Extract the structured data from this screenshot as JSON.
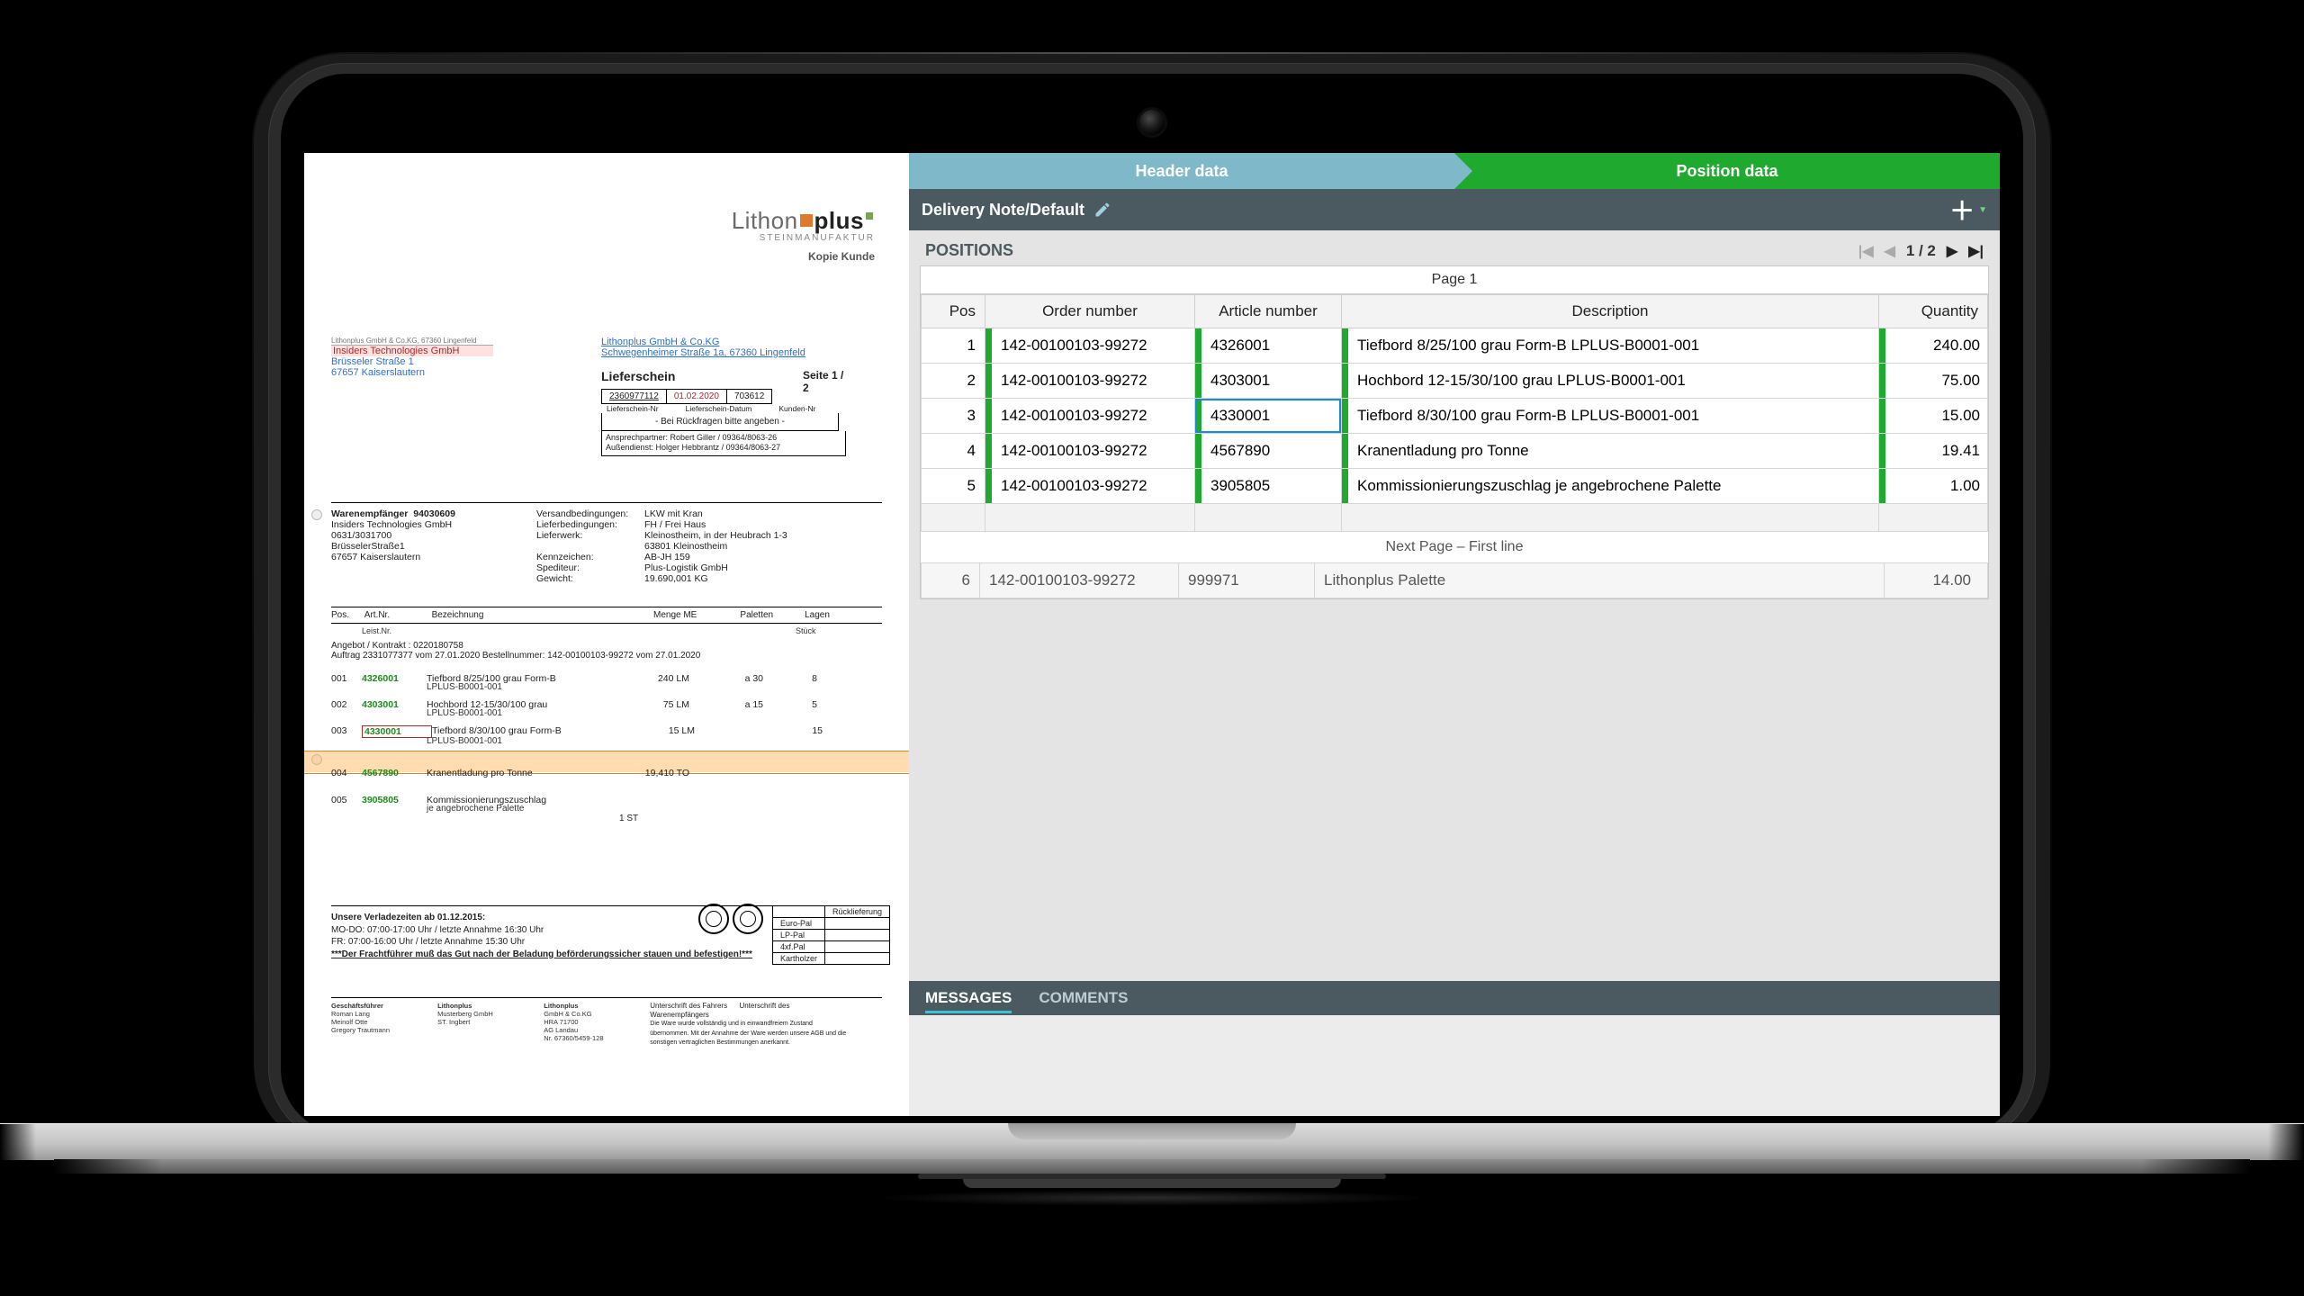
{
  "brand": {
    "name_a": "Lithon",
    "name_b": "plus",
    "sub": "STEINMANUFAKTUR",
    "copy": "Kopie Kunde"
  },
  "sender": {
    "top": "Lithonplus GmbH & Co.KG, 67360 Lingenfeld",
    "l1": "Insiders Technologies GmbH",
    "l2": "Brüsseler Straße 1",
    "l3": "67657 Kaiserslautern"
  },
  "recipient": {
    "l1": "Lithonplus GmbH & Co.KG",
    "l2": "Schwegenheimer Straße 1a, 67360 Lingenfeld"
  },
  "lieferschein": {
    "title": "Lieferschein",
    "page": "Seite 1  /  2",
    "no": "2360977112",
    "date": "01.02.2020",
    "order": "703612",
    "hint": "- Bei Rückfragen bitte angeben -",
    "asp1": "Ansprechpartner: Robert Giller / 09364/8063-26",
    "asp2": "Außendienst: Holger Hebbrantz / 09364/8063-27"
  },
  "meta": {
    "warenempf_lab": "Warenempfänger",
    "warenempf_val": "94030609",
    "c1_l2": "Insiders Technologies GmbH",
    "c1_l3": "0631/3031700",
    "c1_l4": "BrüsselerStraße1",
    "c1_l5": "67657 Kaiserslautern",
    "vb_lab": "Versandbedingungen:",
    "vb_val": "LKW mit Kran",
    "lb_lab": "Lieferbedingungen:",
    "lb_val": "FH / Frei Haus",
    "lw_lab": "Lieferwerk:",
    "lw_val": "Kleinostheim, in der Heubrach 1-3",
    "lw_val2": "63801 Kleinostheim",
    "kz_lab": "Kennzeichen:",
    "kz_val": "AB-JH 159",
    "sp_lab": "Spediteur:",
    "sp_val": "Plus-Logistik GmbH",
    "gw_lab": "Gewicht:",
    "gw_val": "19.690,001 KG"
  },
  "itemsHeader": {
    "pos": "Pos.",
    "art": "Art.Nr.",
    "bez": "Bezeichnung",
    "menge": "Menge  ME",
    "pal": "Paletten",
    "lagen": "Lagen",
    "sub": "Leist.Nr.",
    "sub2": "Stück"
  },
  "angebot": "Angebot / Kontrakt : 0220180758",
  "auftrag": "Auftrag 2331077377  vom 27.01.2020  Bestellnummer: 142-00100103-99272  vom 27.01.2020",
  "docItems": [
    {
      "pos": "001",
      "art": "4326001",
      "bez": "Tiefbord 8/25/100 grau Form-B",
      "me": "240 LM",
      "pal": "a 30",
      "lag": "8",
      "sub": "LPLUS-B0001-001"
    },
    {
      "pos": "002",
      "art": "4303001",
      "bez": "Hochbord 12-15/30/100 grau",
      "me": "75 LM",
      "pal": "a 15",
      "lag": "5",
      "sub": "LPLUS-B0001-001"
    },
    {
      "pos": "003",
      "art": "4330001",
      "bez": "Tiefbord 8/30/100 grau Form-B",
      "me": "15 LM",
      "pal": "",
      "lag": "15",
      "sub": "LPLUS-B0001-001"
    },
    {
      "pos": "004",
      "art": "4567890",
      "bez": "Kranentladung pro Tonne",
      "me": "19,410 TO",
      "pal": "",
      "lag": "",
      "sub": ""
    },
    {
      "pos": "005",
      "art": "3905805",
      "bez": "Kommissionierungszuschlag",
      "me": "1 ST",
      "pal": "",
      "lag": "",
      "sub": "je angebrochene Palette"
    }
  ],
  "foot": {
    "l1": "Unsere Verladezeiten ab 01.12.2015:",
    "l2": "MO-DO: 07:00-17:00 Uhr / letzte Annahme 16:30 Uhr",
    "l3": "FR: 07:00-16:00 Uhr / letzte Annahme 15:30 Uhr",
    "warn": "***Der Frachtführer muß das Gut nach der Beladung beförderungssicher stauen und befestigen!***"
  },
  "palbox": {
    "r1": "Rücklieferung",
    "r2": "Euro-Pal",
    "r3": "LP-Pal",
    "r4": "4xf.Pal",
    "r5": "Kartholzer"
  },
  "foot2": {
    "c1a": "Geschäftsführer",
    "c1b": "Roman Lang",
    "c1c": "Meinolf Otte",
    "c1d": "Gregory Trautmann",
    "c2a": "Lithonplus",
    "c2b": "Musterberg GmbH",
    "c2c": "ST. Ingbert",
    "c3a": "Lithonplus",
    "c3b": "GmbH & Co.KG",
    "c3c": "HRA 71700",
    "c3d": "AG Landau",
    "c3e": "Nr. 67360/5459-128",
    "sig1": "Unterschrift des Fahrers",
    "sig2": "Unterschrift des Warenempfängers",
    "disc": "Die Ware wurde vollständig und in einwandfreiem Zustand übernommen. Mit der Annahme der Ware werden unsere AGB und die sonstigen vertraglichen Bestimmungen anerkannt."
  },
  "tabs": {
    "header": "Header data",
    "position": "Position data"
  },
  "titlebar": {
    "title": "Delivery Note/Default"
  },
  "section": {
    "title": "POSITIONS",
    "pager": "1 / 2",
    "pagelabel": "Page 1",
    "nextpage": "Next Page – First line"
  },
  "cols": {
    "pos": "Pos",
    "order": "Order number",
    "article": "Article number",
    "desc": "Description",
    "qty": "Quantity"
  },
  "rows": [
    {
      "pos": "1",
      "order": "142-00100103-99272",
      "article": "4326001",
      "desc": "Tiefbord 8/25/100 grau Form-B LPLUS-B0001-001",
      "qty": "240.00"
    },
    {
      "pos": "2",
      "order": "142-00100103-99272",
      "article": "4303001",
      "desc": "Hochbord 12-15/30/100 grau LPLUS-B0001-001",
      "qty": "75.00"
    },
    {
      "pos": "3",
      "order": "142-00100103-99272",
      "article": "4330001",
      "desc": "Tiefbord 8/30/100 grau Form-B LPLUS-B0001-001",
      "qty": "15.00"
    },
    {
      "pos": "4",
      "order": "142-00100103-99272",
      "article": "4567890",
      "desc": "Kranentladung pro Tonne",
      "qty": "19.41"
    },
    {
      "pos": "5",
      "order": "142-00100103-99272",
      "article": "3905805",
      "desc": "Kommissionierungszuschlag je angebrochene Palette",
      "qty": "1.00"
    }
  ],
  "row6": {
    "pos": "6",
    "order": "142-00100103-99272",
    "article": "999971",
    "desc": "Lithonplus Palette",
    "qty": "14.00"
  },
  "msgs": {
    "messages": "MESSAGES",
    "comments": "COMMENTS"
  }
}
